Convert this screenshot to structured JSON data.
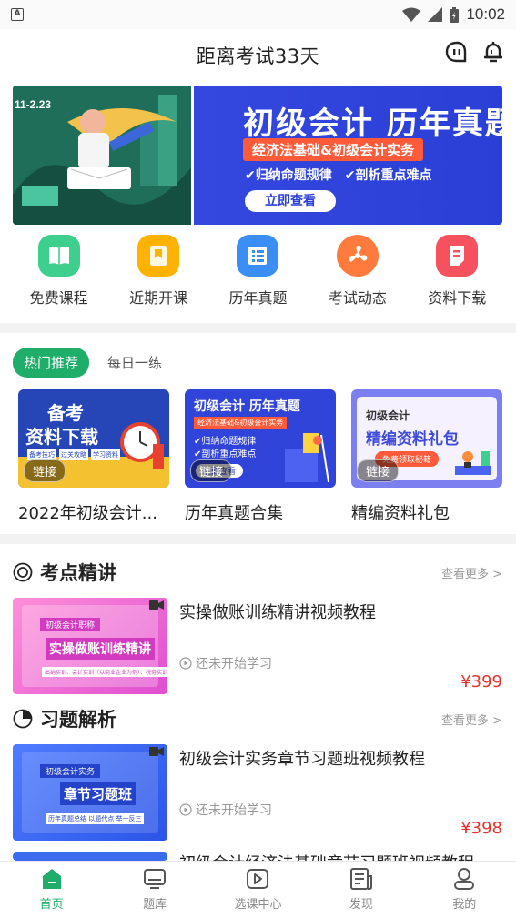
{
  "status_bar": {
    "time": "10:02",
    "app_icon_letter": "A"
  },
  "header": {
    "title": "距离考试33天"
  },
  "banner": {
    "date_tag": "11-2.23",
    "title": "初级会计  历年真题",
    "subtitle": "经济法基础&初级会计实务",
    "bullets": [
      "✔归纳命题规律",
      "✔剖析重点难点"
    ],
    "button": "立即查看"
  },
  "categories": [
    {
      "label": "免费课程",
      "icon": "book-icon",
      "color": "#3ecf8e"
    },
    {
      "label": "近期开课",
      "icon": "calendar-icon",
      "color": "#ffb300"
    },
    {
      "label": "历年真题",
      "icon": "list-icon",
      "color": "#3a8ef6"
    },
    {
      "label": "考试动态",
      "icon": "fan-icon",
      "color": "#ff7a3d"
    },
    {
      "label": "资料下载",
      "icon": "document-icon",
      "color": "#f5515f"
    }
  ],
  "tabs": {
    "active": "热门推荐",
    "other": "每日一练"
  },
  "recommend": [
    {
      "title": "2022年初级会计...",
      "tag": "链接",
      "img_lines": [
        "备考",
        "资料下载"
      ],
      "img_chips": [
        "备考技巧",
        "过关攻略",
        "学习资料"
      ]
    },
    {
      "title": "历年真题合集",
      "tag": "链接",
      "img_lines": [
        "初级会计  历年真题",
        "经济法基础&初级会计实务",
        "✔归纳命题规律",
        "✔剖析重点难点",
        "立即查看"
      ]
    },
    {
      "title": "精编资料礼包",
      "tag": "链接",
      "img_lines": [
        "初级会计",
        "精编资料礼包",
        "免费领取秘籍"
      ]
    }
  ],
  "section1": {
    "title": "考点精讲",
    "more": "查看更多 >"
  },
  "section2": {
    "title": "习题解析",
    "more": "查看更多 >"
  },
  "courses1": [
    {
      "title": "实操做账训练精讲视频教程",
      "status": "还未开始学习",
      "price": "¥399",
      "img_tag": "初级会计职称",
      "img_title": "实操做账训练精讲",
      "img_foot": "出纳实训、会计实训（以商业企业为例）、税务实训"
    }
  ],
  "courses2": [
    {
      "title": "初级会计实务章节习题班视频教程",
      "status": "还未开始学习",
      "price": "¥398",
      "img_tag": "初级会计实务",
      "img_title": "章节习题班",
      "img_foot": "历年真题总结 以题代点 举一反三"
    },
    {
      "title": "初级会计经济法基础章节习题班视频教程"
    }
  ],
  "bottom_nav": [
    {
      "label": "首页",
      "active": true
    },
    {
      "label": "题库",
      "active": false
    },
    {
      "label": "选课中心",
      "active": false
    },
    {
      "label": "发现",
      "active": false
    },
    {
      "label": "我的",
      "active": false
    }
  ],
  "colors": {
    "accent": "#1fae6a",
    "price": "#e8322e",
    "banner_blue": "#2a3fd6"
  }
}
